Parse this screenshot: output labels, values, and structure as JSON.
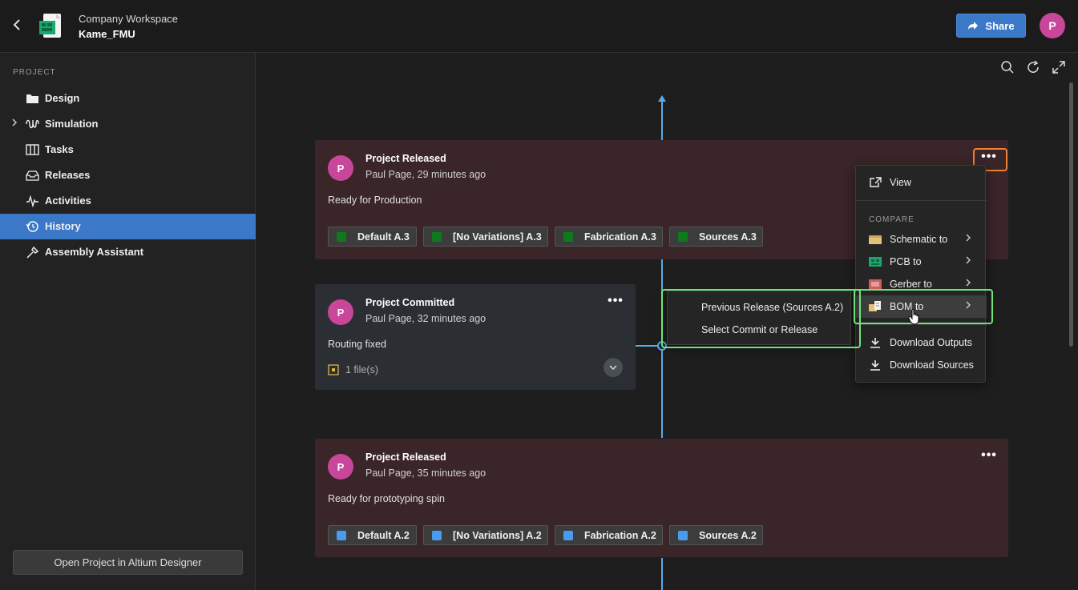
{
  "header": {
    "workspace": "Company Workspace",
    "project": "Kame_FMU",
    "share_label": "Share",
    "avatar_initial": "P"
  },
  "sidebar": {
    "section_label": "PROJECT",
    "items": [
      {
        "label": "Design",
        "icon": "folder-icon"
      },
      {
        "label": "Simulation",
        "icon": "waveform-icon"
      },
      {
        "label": "Tasks",
        "icon": "board-icon"
      },
      {
        "label": "Releases",
        "icon": "inbox-icon"
      },
      {
        "label": "Activities",
        "icon": "pulse-icon"
      },
      {
        "label": "History",
        "icon": "history-icon",
        "active": true
      },
      {
        "label": "Assembly Assistant",
        "icon": "wrench-icon"
      }
    ],
    "open_button": "Open Project in Altium Designer"
  },
  "timeline": {
    "cards": [
      {
        "title": "Project Released",
        "subtitle": "Paul Page, 29 minutes ago",
        "description": "Ready for Production",
        "tags": [
          "Default A.3",
          "[No Variations] A.3",
          "Fabrication A.3",
          "Sources A.3"
        ],
        "tag_color": "#0f7a1c"
      },
      {
        "title": "Project Committed",
        "subtitle": "Paul Page, 32 minutes ago",
        "description": "Routing fixed",
        "files": "1 file(s)"
      },
      {
        "title": "Project Released",
        "subtitle": "Paul Page, 35 minutes ago",
        "description": "Ready for prototyping spin",
        "tags": [
          "Default A.2",
          "[No Variations] A.2",
          "Fabrication A.2",
          "Sources A.2"
        ],
        "tag_color": "#4a9bf0"
      }
    ]
  },
  "context_menu": {
    "view": "View",
    "compare_caption": "COMPARE",
    "schematic": "Schematic to",
    "pcb": "PCB to",
    "gerber": "Gerber to",
    "bom": "BOM to",
    "download_outputs": "Download Outputs",
    "download_sources": "Download Sources"
  },
  "submenu": {
    "previous_release": "Previous Release (Sources A.2)",
    "select_commit": "Select Commit or Release"
  },
  "colors": {
    "accent": "#3b78c7",
    "highlight_green": "#6ee37a",
    "highlight_orange": "#f08030",
    "avatar": "#c8479a",
    "timeline": "#5aa9e6"
  }
}
